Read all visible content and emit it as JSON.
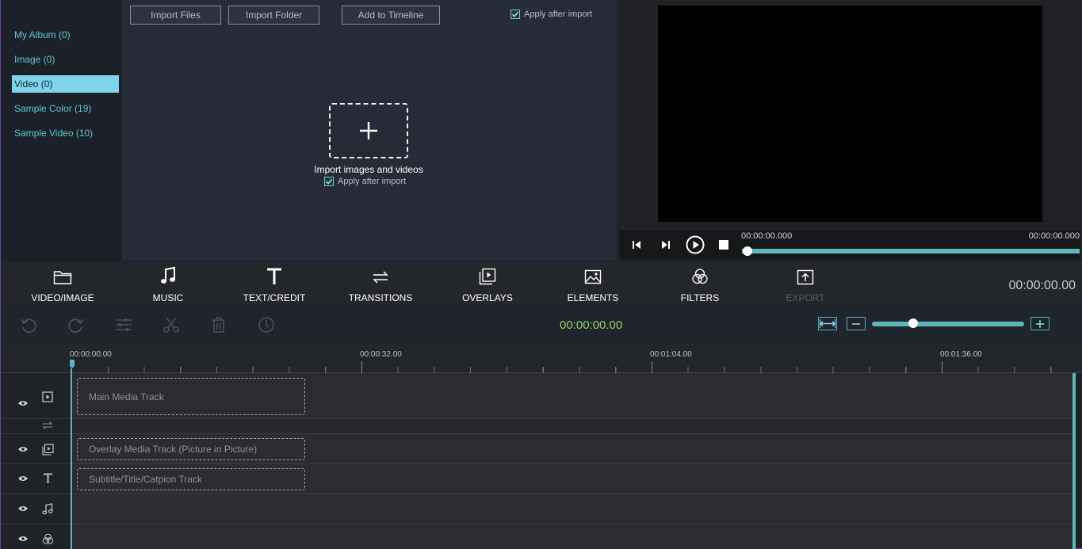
{
  "sidebar": {
    "items": [
      {
        "label": "My Album (0)",
        "active": false
      },
      {
        "label": "Image (0)",
        "active": false
      },
      {
        "label": "Video (0)",
        "active": true
      },
      {
        "label": "Sample Color (19)",
        "active": false
      },
      {
        "label": "Sample Video (10)",
        "active": false
      }
    ]
  },
  "media": {
    "import_files": "Import Files",
    "import_folder": "Import Folder",
    "add_to_timeline": "Add to Timeline",
    "apply_after_import_top": "Apply after import",
    "drop_label": "Import images and videos",
    "apply_after_import": "Apply after import"
  },
  "preview": {
    "current_time": "00:00:00.000",
    "total_time": "00:00:00.000",
    "progress": 0
  },
  "tabs": [
    {
      "label": "VIDEO/IMAGE",
      "icon": "folder-icon",
      "enabled": true
    },
    {
      "label": "MUSIC",
      "icon": "music-note-icon",
      "enabled": true
    },
    {
      "label": "TEXT/CREDIT",
      "icon": "text-icon",
      "enabled": true
    },
    {
      "label": "TRANSITIONS",
      "icon": "transitions-icon",
      "enabled": true
    },
    {
      "label": "OVERLAYS",
      "icon": "overlays-icon",
      "enabled": true
    },
    {
      "label": "ELEMENTS",
      "icon": "image-icon",
      "enabled": true
    },
    {
      "label": "FILTERS",
      "icon": "filters-icon",
      "enabled": true
    },
    {
      "label": "EXPORT",
      "icon": "export-icon",
      "enabled": false
    }
  ],
  "tabs_time": "00:00:00.00",
  "timeline": {
    "current_time": "00:00:00.00",
    "zoom_level": 0.27,
    "ruler_labels": [
      "00:00:00.00",
      "00:00:32.00",
      "00:01:04.00",
      "00:01:36.00"
    ],
    "tracks": {
      "main": "Main Media Track",
      "overlay": "Overlay Media Track (Picture in Picture)",
      "subtitle": "Subtitle/Title/Catpion Track"
    }
  },
  "colors": {
    "accent": "#5fb5bb",
    "sidebar_text": "#5ec7ce",
    "active_item": "#7fd3ea",
    "timecode_green": "#8fd16a"
  }
}
